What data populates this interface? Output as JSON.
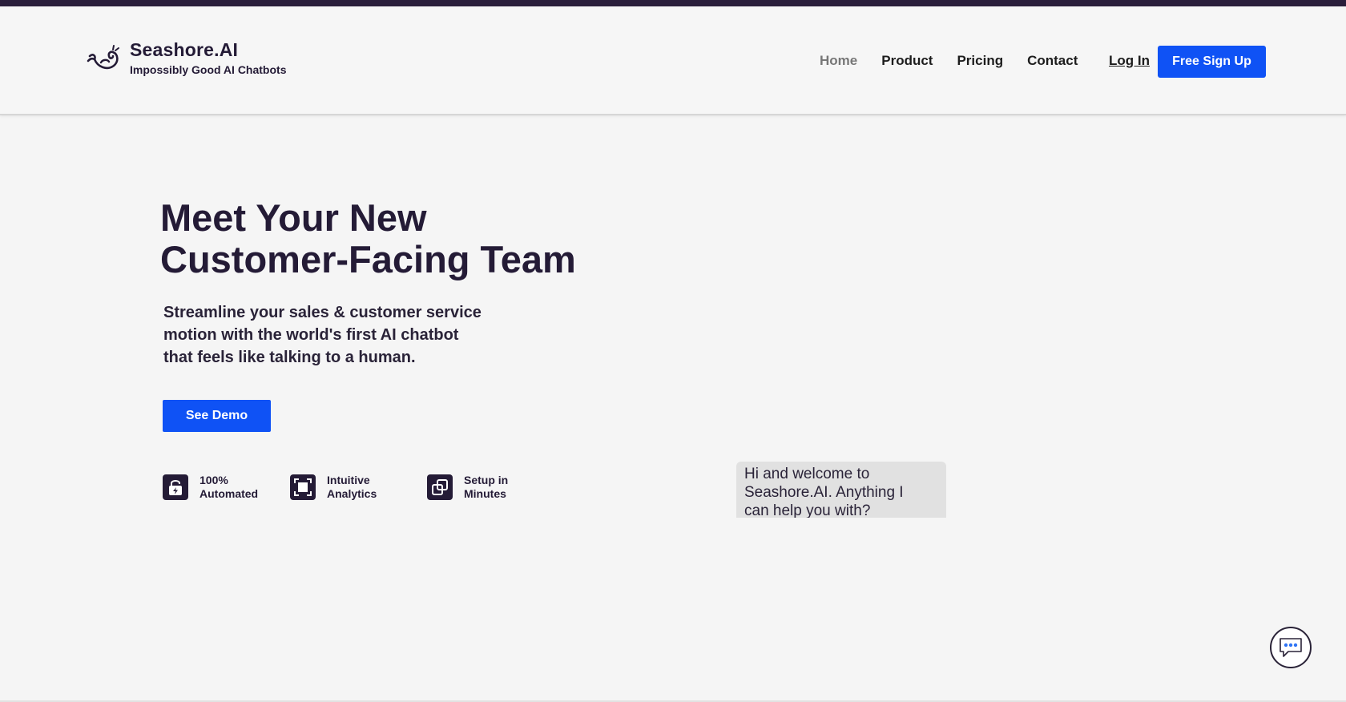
{
  "header": {
    "brand_name": "Seashore.AI",
    "brand_tagline": "Impossibly Good AI Chatbots",
    "logo_icon": "whale-icon",
    "nav": [
      {
        "label": "Home",
        "active": true
      },
      {
        "label": "Product",
        "active": false
      },
      {
        "label": "Pricing",
        "active": false
      },
      {
        "label": "Contact",
        "active": false
      }
    ],
    "login_label": "Log In",
    "signup_label": "Free Sign Up"
  },
  "hero": {
    "headline_line1": "Meet Your New",
    "headline_line2": "Customer-Facing Team",
    "subtext_line1": "Streamline your sales & customer service",
    "subtext_line2": "motion with the world's first AI chatbot",
    "subtext_line3": "that feels like talking to a human.",
    "demo_label": "See Demo"
  },
  "features": [
    {
      "icon": "lock-bolt-icon",
      "line1": "100%",
      "line2": "Automated"
    },
    {
      "icon": "square-frame-icon",
      "line1": "Intuitive",
      "line2": "Analytics"
    },
    {
      "icon": "overlap-squares-icon",
      "line1": "Setup in",
      "line2": "Minutes"
    }
  ],
  "chat": {
    "line1": "Hi and welcome to",
    "line2": "Seashore.AI. Anything I",
    "line3": "can help you with?",
    "fab_icon": "chat-bubble-icon"
  },
  "colors": {
    "brand_dark": "#241b36",
    "accent_blue": "#0f52f5",
    "background": "#f5f5f5"
  }
}
